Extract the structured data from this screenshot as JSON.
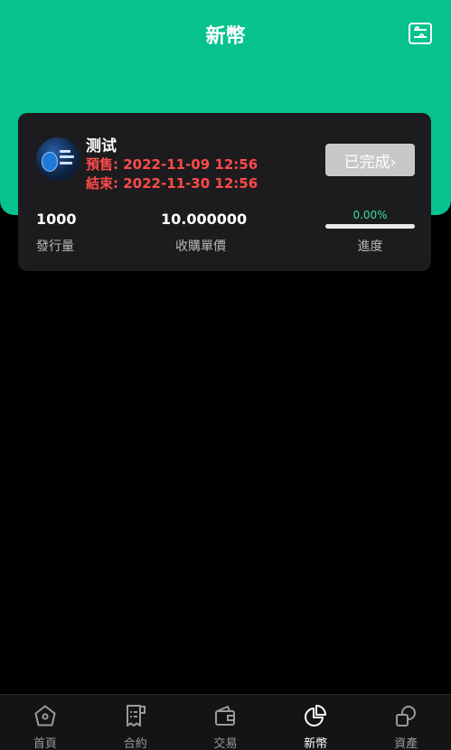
{
  "header": {
    "title": "新幣"
  },
  "card": {
    "coin_name": "测试",
    "presale": "預售: 2022-11-09 12:56",
    "end": "結束: 2022-11-30 12:56",
    "status_button": "已完成›",
    "issue_amount": {
      "value": "1000",
      "label": "發行量"
    },
    "unit_price": {
      "value": "10.000000",
      "label": "收購單價"
    },
    "progress": {
      "percent_text": "0.00%",
      "fraction": 0.0,
      "label": "進度"
    }
  },
  "tabbar": {
    "items": [
      {
        "label": "首頁",
        "icon": "home-icon",
        "active": false
      },
      {
        "label": "合約",
        "icon": "contract-icon",
        "active": false
      },
      {
        "label": "交易",
        "icon": "wallet-icon",
        "active": false
      },
      {
        "label": "新幣",
        "icon": "pie-chart-icon",
        "active": true
      },
      {
        "label": "資產",
        "icon": "assets-icon",
        "active": false
      }
    ]
  },
  "colors": {
    "brand": "#07c28f",
    "danger": "#ff4a4a",
    "card": "#1c1c1e"
  }
}
